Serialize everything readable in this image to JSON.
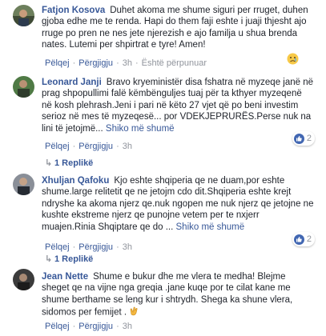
{
  "comments": [
    {
      "author": "Fatjon Kosova",
      "text": "Duhet akoma me shume siguri per rruget, duhen gjoba edhe me te renda. Hapi do them faji eshte i juaji thjesht ajo rruge po pren ne nes jete njerezish e ajo familja u shua brenda nates. Lutemi per shpirtrat e tyre! Amen!",
      "actions": {
        "like": "Pëlqej",
        "reply": "Përgjigju",
        "time": "3h",
        "edited": "Është përpunuar"
      },
      "reaction_icon": "sad-emoji-icon"
    },
    {
      "author": "Leonard Janji",
      "text": "Bravo kryeministër disa fshatra në myzeqe janë në prag shpopullimi falë këmbënguljes tuaj për ta kthyer myzeqenë në kosh plehrash.Jeni i pari në këto 27 vjet që po beni investim serioz në mes të myzeqesë... por VDEKJEPRURËS.Perse nuk na lini të jetojmë...",
      "more": "Shiko më shumë",
      "actions": {
        "like": "Pëlqej",
        "reply": "Përgjigju",
        "time": "3h"
      },
      "reactions": {
        "count": "2"
      },
      "reply_count": "1 Replikë"
    },
    {
      "author": "Xhuljan Qafoku",
      "text": "Kjo eshte shqiperia qe ne duam,por eshte shume.large relitetit qe ne jetojm cdo dit.Shqiperia eshte krejt ndryshe ka akoma njerz qe.nuk ngopen me nuk njerz qe jetojne ne kushte ekstreme njerz qe punojne vetem per te nxjerr muajen.Rinia Shqiptare qe do ...",
      "more": "Shiko më shumë",
      "actions": {
        "like": "Pëlqej",
        "reply": "Përgjigju",
        "time": "3h"
      },
      "reactions": {
        "count": "2"
      },
      "reply_count": "1 Replikë"
    },
    {
      "author": "Jean Nette",
      "text": "Shume e bukur dhe me vlera te medha! Blejme sheget qe na vijne nga greqia .jane kuqe por te cilat kane me shume berthame se leng kur i shtrydh. Shega ka shune vlera, sidomos per femijet .",
      "emoji": "clapping-hands-icon",
      "actions": {
        "like": "Pëlqej",
        "reply": "Përgjigju",
        "time": "3h"
      }
    }
  ],
  "colors": {
    "link": "#385898",
    "meta": "#90949c",
    "like": "#4267b2"
  }
}
